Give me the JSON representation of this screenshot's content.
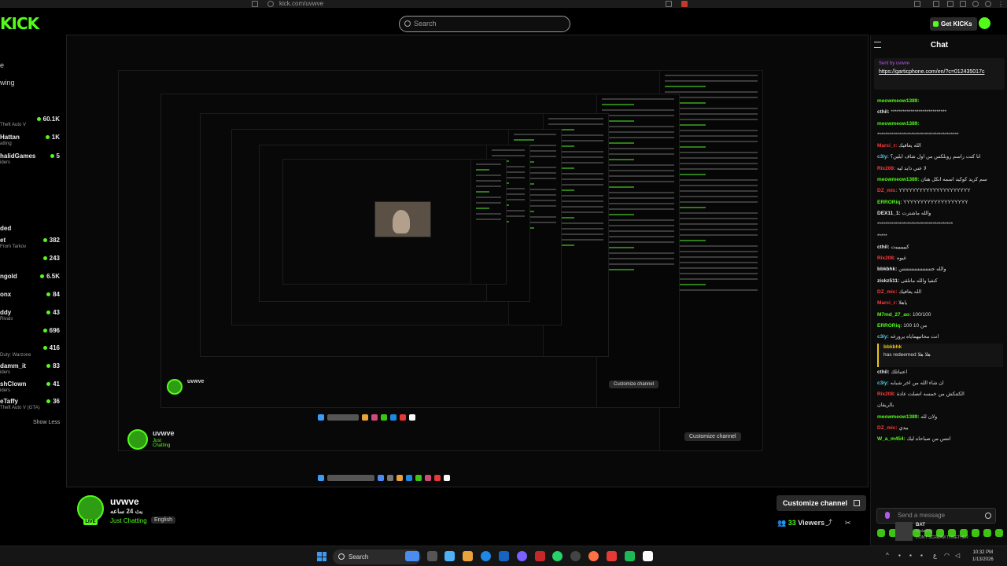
{
  "browser": {
    "url": "kick.com/uvwve"
  },
  "header": {
    "logo": "KICK",
    "search_placeholder": "Search",
    "get_kicks": "Get KICKs"
  },
  "sidebar": {
    "nav": [
      "e",
      "wing"
    ],
    "channels": [
      {
        "name": "",
        "sub": "Theft Auto V",
        "viewers": "60.1K"
      },
      {
        "name": "Hattan",
        "sub": "atting",
        "viewers": "1K"
      },
      {
        "name": "halidGames",
        "sub": "iders",
        "viewers": "5"
      },
      {
        "name": "ded",
        "sub": "",
        "viewers": ""
      },
      {
        "name": "et",
        "sub": "From Tarkov",
        "viewers": "382"
      },
      {
        "name": "",
        "sub": "",
        "viewers": "243"
      },
      {
        "name": "ngold",
        "sub": "",
        "viewers": "6.5K"
      },
      {
        "name": "onx",
        "sub": "",
        "viewers": "84"
      },
      {
        "name": "ddy",
        "sub": "Rivals",
        "viewers": "43"
      },
      {
        "name": "",
        "sub": "",
        "viewers": "696"
      },
      {
        "name": "",
        "sub": "Duty: Warzone",
        "viewers": "416"
      },
      {
        "name": "damm_it",
        "sub": "iders",
        "viewers": "83"
      },
      {
        "name": "shClown",
        "sub": "iders",
        "viewers": "41"
      },
      {
        "name": "eTaffy",
        "sub": "Theft Auto V (GTA)",
        "viewers": "36"
      }
    ],
    "show_less": "Show Less"
  },
  "channel": {
    "name": "uvwve",
    "title": "بث 24 ساعه",
    "category": "Just Chatting",
    "language": "English",
    "live_badge": "LIVE",
    "customize": "Customize channel",
    "viewers_count": "33",
    "viewers_label": "Viewers"
  },
  "chat": {
    "title": "Chat",
    "pinned_by_label": "Sent by",
    "pinned_by_user": "uvwve",
    "pinned_link": "https://garticphone.com/en/?c=012435017c",
    "messages": [
      {
        "user": "meowmeow1389:",
        "color": "g",
        "text": ""
      },
      {
        "user": "cthil:",
        "color": "w",
        "text": "****************************"
      },
      {
        "user": "meowmeow1389:",
        "color": "g",
        "text": ""
      },
      {
        "user": "",
        "color": "w",
        "text": "*****************************************"
      },
      {
        "user": "Marci_r:",
        "color": "r",
        "text": "الله يعافيك"
      },
      {
        "user": "c3iy:",
        "color": "b",
        "text": "انا كنت راسم روبلكس من اول شاف ايلين؟"
      },
      {
        "user": "Rix208:",
        "color": "r",
        "text": "لا عني دايد ليه"
      },
      {
        "user": "meowmeow1389:",
        "color": "g",
        "text": "سم كريد كوكيد اسمه انكل هنان"
      },
      {
        "user": "DZ_mic:",
        "color": "r",
        "text": "YYYYYYYYYYYYYYYYYYYYY"
      },
      {
        "user": "ERRORiq:",
        "color": "g",
        "text": "YYYYYYYYYYYYYYYYYYY"
      },
      {
        "user": "DEX11_1:",
        "color": "w",
        "text": "والله ماشترت"
      },
      {
        "user": "",
        "color": "w",
        "text": "**************************************"
      },
      {
        "user": "",
        "color": "w",
        "text": "*****"
      },
      {
        "user": "cthil:",
        "color": "w",
        "text": "كيييييييت"
      },
      {
        "user": "Rix208:",
        "color": "r",
        "text": "غيوه"
      },
      {
        "user": "bbkbhk:",
        "color": "w",
        "text": "والله جنننننننننننننننننننن"
      },
      {
        "user": "ziskz511:",
        "color": "w",
        "text": "كنفيا والله ماتلقى"
      },
      {
        "user": "DZ_mic:",
        "color": "r",
        "text": "الله يعافيك"
      },
      {
        "user": "Marci_r:",
        "color": "r",
        "text": "ياهلا"
      },
      {
        "user": "M7md_27_ao:",
        "color": "g",
        "text": "100/100"
      },
      {
        "user": "ERRORiq:",
        "color": "g",
        "text": "100 من 10"
      },
      {
        "user": "c3iy:",
        "color": "b",
        "text": "انت محاتيهماياه يرورغه"
      }
    ],
    "redeem": {
      "user": "bbkbhk",
      "text": "has redeemed",
      "reward": "هلا هلا"
    },
    "messages2": [
      {
        "user": "cthil:",
        "color": "w",
        "text": "اعتباتلك"
      },
      {
        "user": "c3iy:",
        "color": "b",
        "text": "ان شاء الله من اخر شبابه"
      },
      {
        "user": "Rix208:",
        "color": "r",
        "text": "الكتنكش من خمسه اتصلت عادة"
      },
      {
        "user": "",
        "color": "w",
        "text": "بالريقان"
      },
      {
        "user": "meowmeow1389:",
        "color": "g",
        "text": "ولان لله"
      },
      {
        "user": "DZ_mic:",
        "color": "r",
        "text": "بيدي"
      },
      {
        "user": "W_a_m454:",
        "color": "g",
        "text": "انتس من صباحاه ليك"
      }
    ],
    "send_placeholder": "Send a message",
    "now_playing": {
      "user": "BAT",
      "status": "is playing",
      "song": "DON'T SCREAM TOGETHER"
    }
  },
  "taskbar": {
    "search": "Search",
    "time": "10:32 PM",
    "date": "1/13/2026"
  },
  "colors": {
    "brand": "#53fc18",
    "bg": "#000000",
    "panel": "#0b0b0b"
  }
}
